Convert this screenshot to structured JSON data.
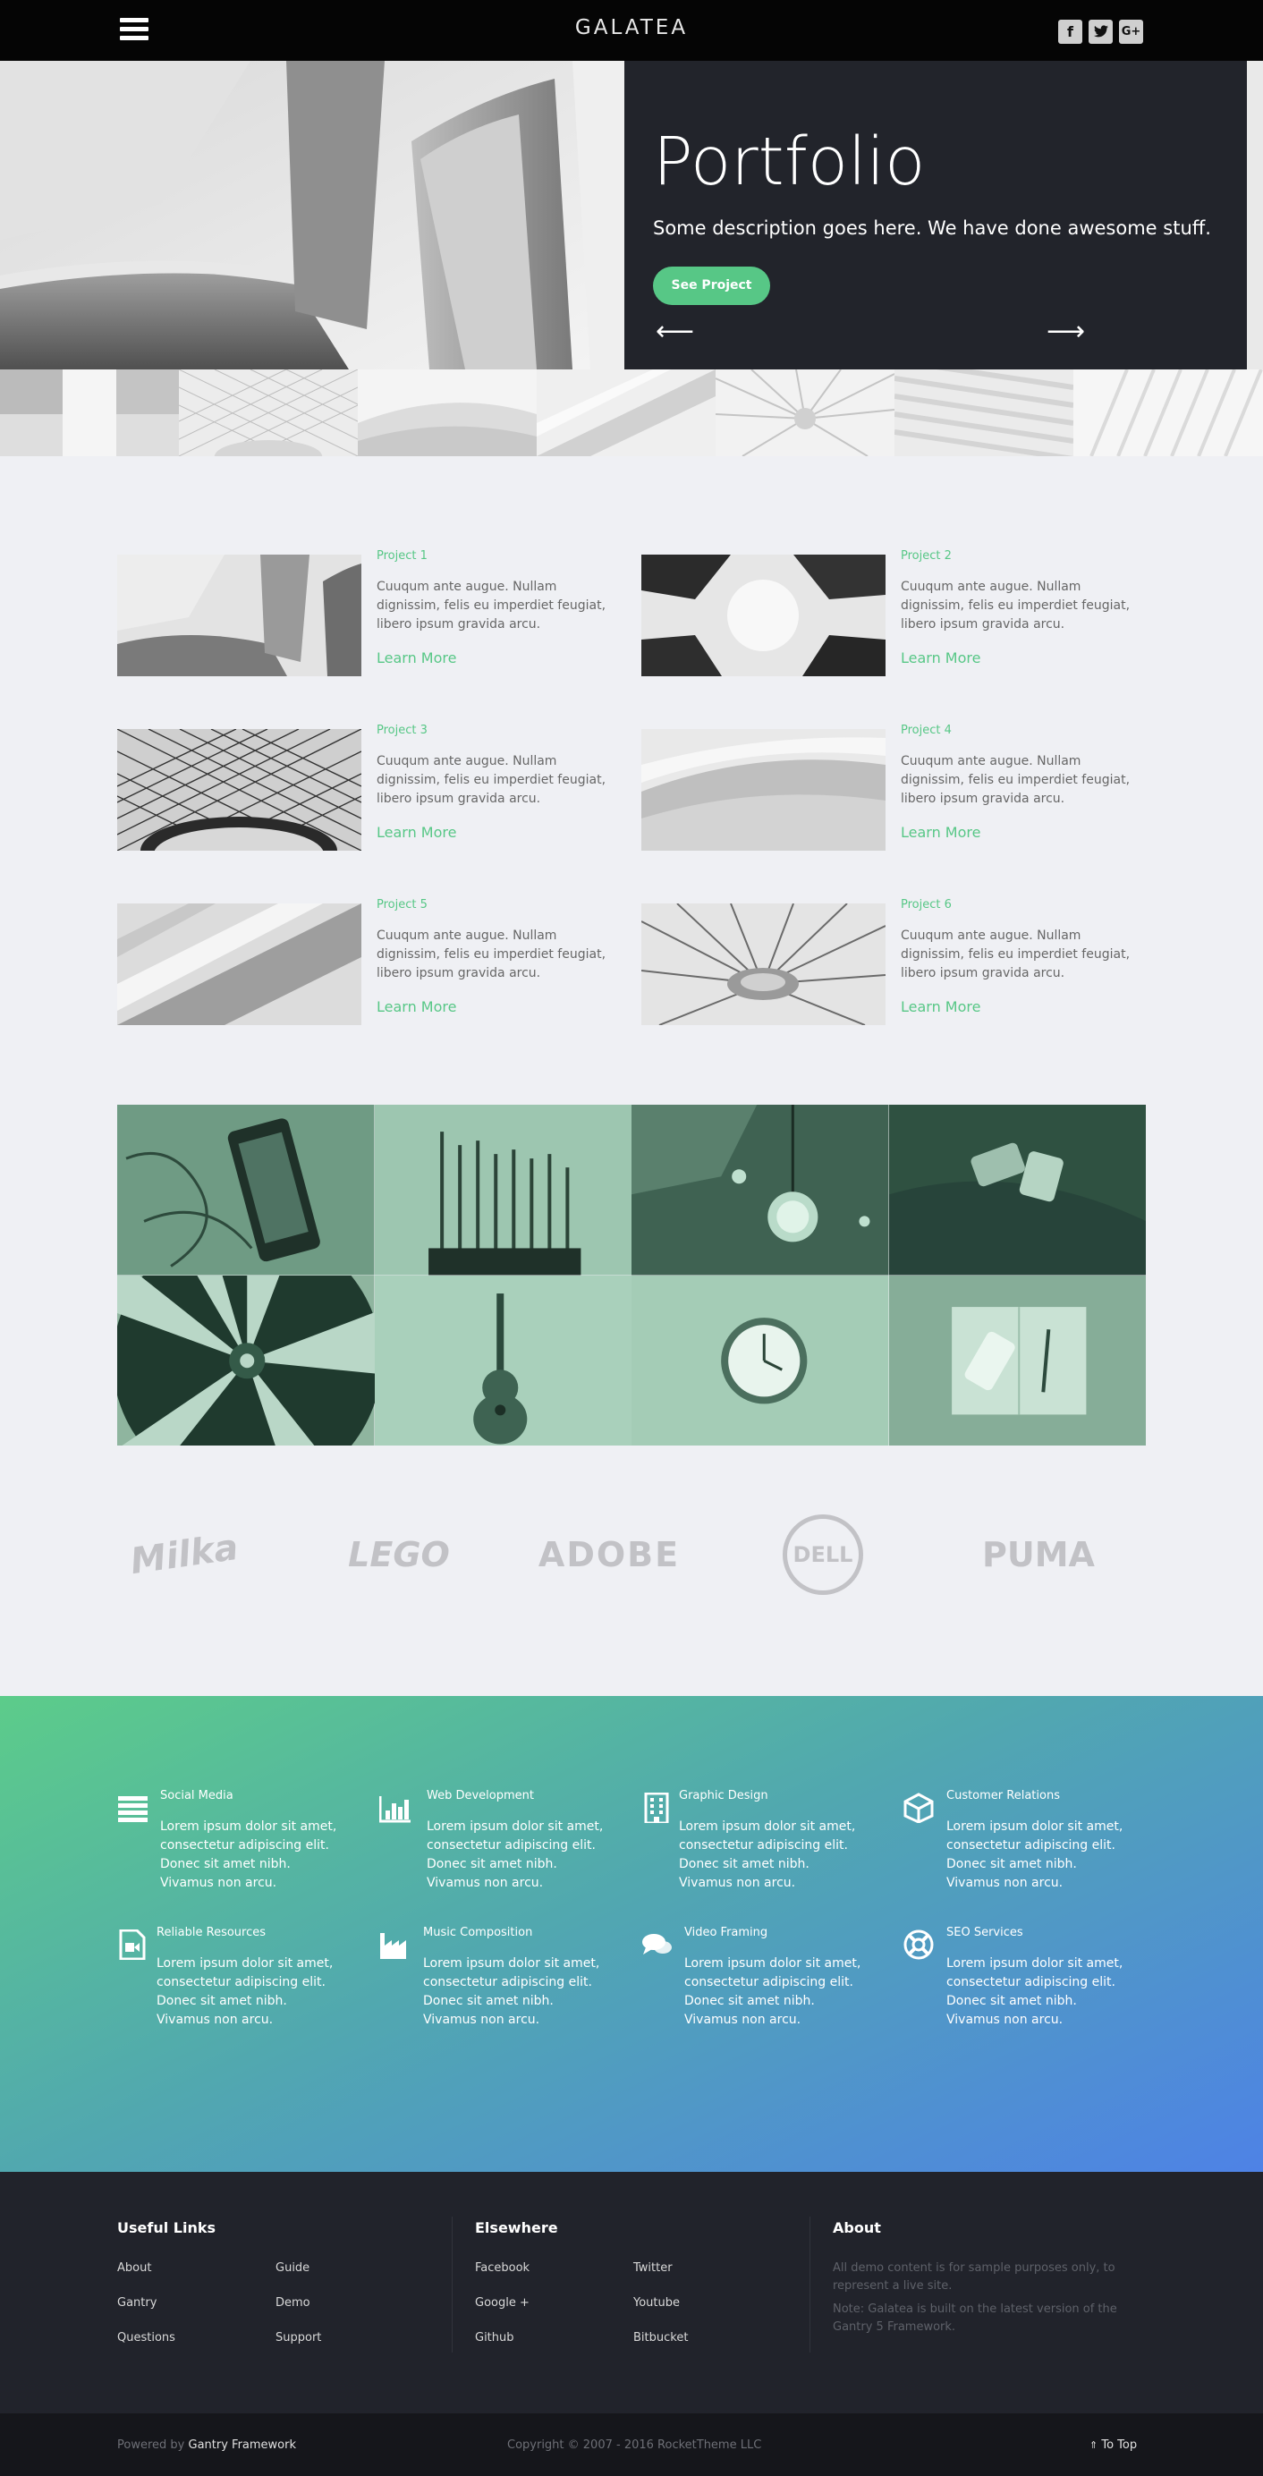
{
  "header": {
    "logo": "GALATEA",
    "social": [
      {
        "icon": "facebook-icon",
        "glyph": "f"
      },
      {
        "icon": "twitter-icon",
        "glyph": "t"
      },
      {
        "icon": "google-plus-icon",
        "glyph": "G+"
      }
    ]
  },
  "hero": {
    "title": "Portfolio",
    "description": "Some description goes here. We have done awesome stuff.",
    "button_label": "See Project",
    "prev_arrow": "⟵",
    "next_arrow": "⟶"
  },
  "projects": [
    {
      "title": "Project 1",
      "text": "Cuuqum ante augue. Nullam dignissim, felis eu imperdiet feugiat, libero ipsum gravida arcu.",
      "link": "Learn More"
    },
    {
      "title": "Project 2",
      "text": "Cuuqum ante augue. Nullam dignissim, felis eu imperdiet feugiat, libero ipsum gravida arcu.",
      "link": "Learn More"
    },
    {
      "title": "Project 3",
      "text": "Cuuqum ante augue. Nullam dignissim, felis eu imperdiet feugiat, libero ipsum gravida arcu.",
      "link": "Learn More"
    },
    {
      "title": "Project 4",
      "text": "Cuuqum ante augue. Nullam dignissim, felis eu imperdiet feugiat, libero ipsum gravida arcu.",
      "link": "Learn More"
    },
    {
      "title": "Project 5",
      "text": "Cuuqum ante augue. Nullam dignissim, felis eu imperdiet feugiat, libero ipsum gravida arcu.",
      "link": "Learn More"
    },
    {
      "title": "Project 6",
      "text": "Cuuqum ante augue. Nullam dignissim, felis eu imperdiet feugiat, libero ipsum gravida arcu.",
      "link": "Learn More"
    }
  ],
  "brands": [
    "Milka",
    "LEGO",
    "ADOBE",
    "DELL",
    "PUMA"
  ],
  "services": [
    {
      "icon": "list-icon",
      "title": "Social Media",
      "text": "Lorem ipsum dolor sit amet, consectetur adipiscing elit. Donec sit amet nibh. Vivamus non arcu."
    },
    {
      "icon": "bar-chart-icon",
      "title": "Web Development",
      "text": "Lorem ipsum dolor sit amet, consectetur adipiscing elit. Donec sit amet nibh. Vivamus non arcu."
    },
    {
      "icon": "building-icon",
      "title": "Graphic Design",
      "text": "Lorem ipsum dolor sit amet, consectetur adipiscing elit. Donec sit amet nibh. Vivamus non arcu."
    },
    {
      "icon": "cube-icon",
      "title": "Customer Relations",
      "text": "Lorem ipsum dolor sit amet, consectetur adipiscing elit. Donec sit amet nibh. Vivamus non arcu."
    },
    {
      "icon": "file-video-icon",
      "title": "Reliable Resources",
      "text": "Lorem ipsum dolor sit amet, consectetur adipiscing elit. Donec sit amet nibh. Vivamus non arcu."
    },
    {
      "icon": "industry-icon",
      "title": "Music Composition",
      "text": "Lorem ipsum dolor sit amet, consectetur adipiscing elit. Donec sit amet nibh. Vivamus non arcu."
    },
    {
      "icon": "comments-icon",
      "title": "Video Framing",
      "text": "Lorem ipsum dolor sit amet, consectetur adipiscing elit. Donec sit amet nibh. Vivamus non arcu."
    },
    {
      "icon": "life-ring-icon",
      "title": "SEO Services",
      "text": "Lorem ipsum dolor sit amet, consectetur adipiscing elit. Donec sit amet nibh. Vivamus non arcu."
    }
  ],
  "footer": {
    "useful_title": "Useful Links",
    "useful_links": [
      "About",
      "Guide",
      "Gantry",
      "Demo",
      "Questions",
      "Support"
    ],
    "elsewhere_title": "Elsewhere",
    "elsewhere_links": [
      "Facebook",
      "Twitter",
      "Google +",
      "Youtube",
      "Github",
      "Bitbucket"
    ],
    "about_title": "About",
    "about_text1": "All demo content is for sample purposes only, to represent a live site.",
    "about_text2": "Note: Galatea is built on the latest version of the Gantry 5 Framework."
  },
  "bottom": {
    "powered_prefix": "Powered by",
    "powered_link": "Gantry Framework",
    "copyright": "Copyright © 2007 - 2016 RocketTheme LLC",
    "to_top": "To Top",
    "to_top_icon": "⇑"
  },
  "colors": {
    "accent": "#57c786",
    "dark": "#22242b",
    "black": "#050505",
    "footer": "#21232b",
    "gradient_start": "#5ccc8a",
    "gradient_end": "#4e82e6"
  }
}
